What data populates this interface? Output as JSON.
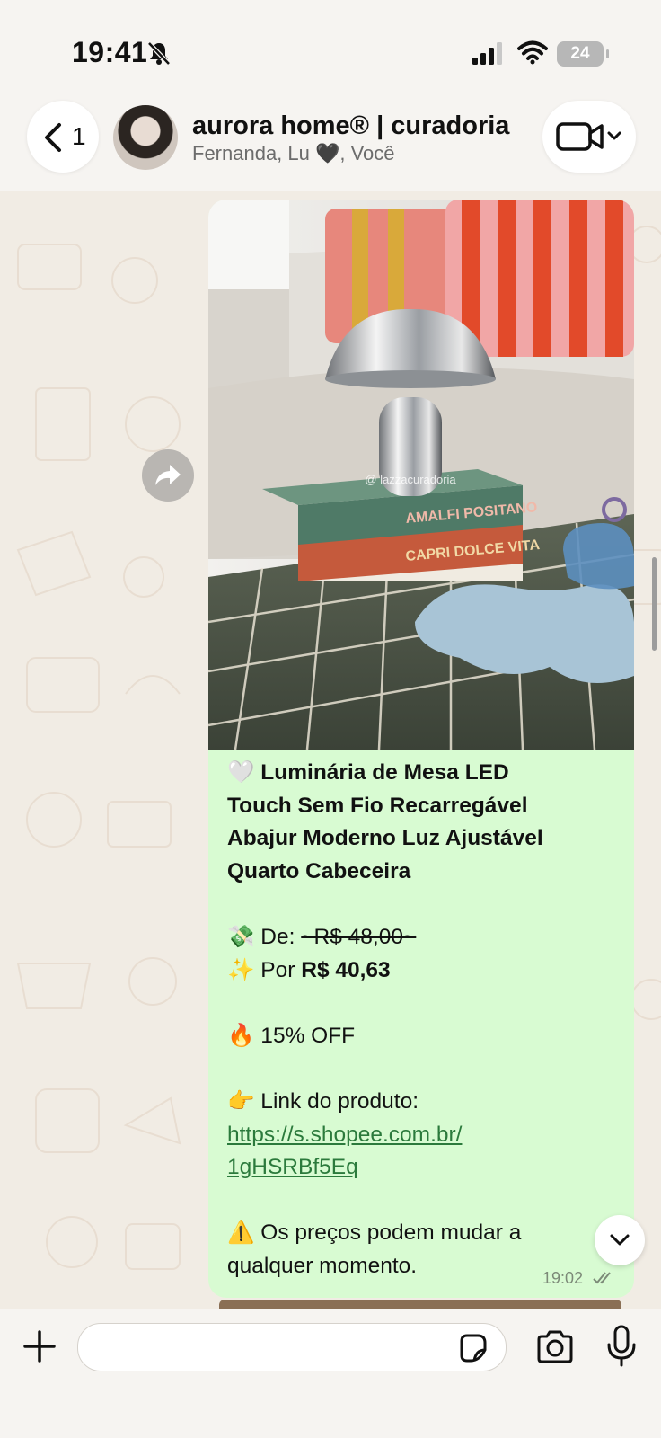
{
  "status_bar": {
    "time": "19:41",
    "battery": "24"
  },
  "header": {
    "back_count": "1",
    "chat_title": "aurora home® | curadoria",
    "participants": "Fernanda, Lu 🖤, Você"
  },
  "message": {
    "photo_watermark": "@ lazzacuradoria",
    "book_titles": [
      "AMALFI POSITANO",
      "CAPRI DOLCE VITA"
    ],
    "product_title_lines": [
      "🤍 Luminária de Mesa LED",
      "Touch Sem Fio Recarregável",
      "Abajur Moderno Luz Ajustável",
      "Quarto Cabeceira"
    ],
    "price_from_prefix": "💸 De: ",
    "price_from": "~R$ 48,00~",
    "price_to_prefix": "✨ Por ",
    "price_to": "R$ 40,63",
    "discount": "🔥 15% OFF",
    "link_label": "👉 Link do produto:",
    "link_line1": "https://s.shopee.com.br/",
    "link_line2": "1gHSRBf5Eq",
    "warning_line1": "⚠️ Os preços podem mudar a",
    "warning_line2": "qualquer momento.",
    "time": "19:02"
  },
  "icons": {
    "back": "chevron-left-icon",
    "video": "video-camera-icon",
    "forward": "forward-icon",
    "scroll": "chevron-down-icon",
    "plus": "plus-icon",
    "sticker": "sticker-icon",
    "camera": "camera-icon",
    "mic": "microphone-icon"
  },
  "colors": {
    "bubble": "#d8fbd2",
    "link": "#2b7a3c",
    "background": "#f1ece4"
  }
}
